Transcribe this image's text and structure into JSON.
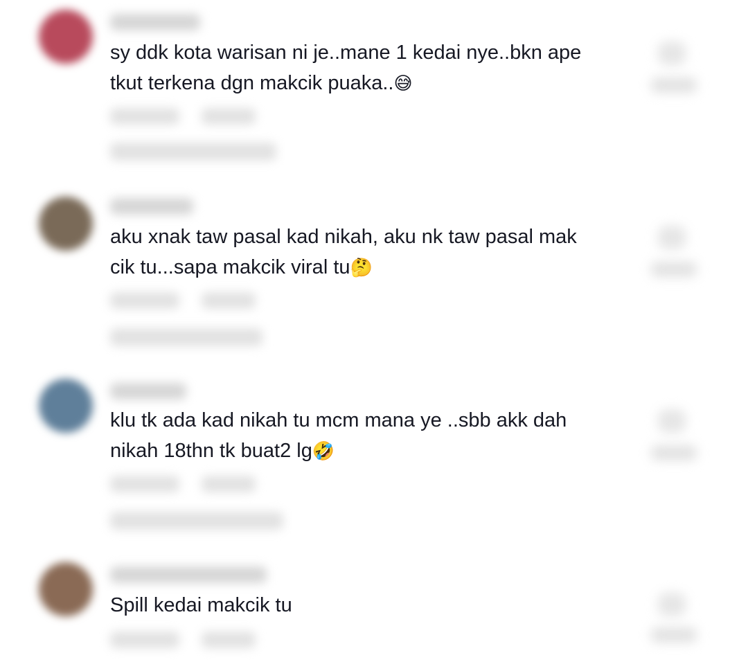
{
  "comments": [
    {
      "text": "sy ddk kota warisan ni je..mane 1 kedai nye..bkn ape\ntkut terkena dgn makcik puaka..",
      "emoji": "😅",
      "avatar_color": "#b84a5c"
    },
    {
      "text": "aku xnak taw pasal kad nikah, aku nk taw pasal mak\ncik tu...sapa makcik viral tu",
      "emoji": "🤔",
      "avatar_color": "#7a6a58"
    },
    {
      "text": "klu tk ada kad nikah tu mcm mana ye ..sbb akk dah\nnikah 18thn tk buat2 lg",
      "emoji": "🤣",
      "avatar_color": "#5f7f9a"
    },
    {
      "text": "Spill kedai makcik tu",
      "emoji": "",
      "avatar_color": "#8a6a55"
    }
  ]
}
